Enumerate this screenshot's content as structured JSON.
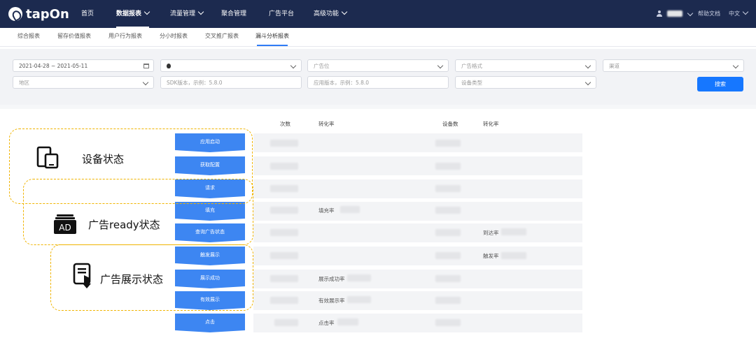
{
  "brand": {
    "name": "tapOn"
  },
  "nav": [
    {
      "label": "首页"
    },
    {
      "label": "数据报表",
      "active": true
    },
    {
      "label": "流量管理"
    },
    {
      "label": "聚合管理"
    },
    {
      "label": "广告平台"
    },
    {
      "label": "高级功能"
    }
  ],
  "top_right": {
    "help": "帮助文档",
    "lang": "中文"
  },
  "subtabs": [
    {
      "label": "综合报表"
    },
    {
      "label": "留存价值报表"
    },
    {
      "label": "用户行为报表"
    },
    {
      "label": "分小时报表"
    },
    {
      "label": "交叉推广报表"
    },
    {
      "label": "漏斗分析报表",
      "active": true
    }
  ],
  "filters": {
    "date_range": "2021-04-28 ~ 2021-05-11",
    "platform": "",
    "ad_slot": "广告位",
    "ad_format": "广告格式",
    "channel": "渠道",
    "region": "地区",
    "sdk_version": "SDK版本，示例：5.8.0",
    "app_version": "应用版本，示例：5.8.0",
    "device_type": "设备类型",
    "search_label": "搜索"
  },
  "table_headers": {
    "count": "次数",
    "conv_rate": "转化率",
    "device_count": "设备数",
    "conv_rate2": "转化率"
  },
  "funnel_steps": [
    {
      "label": "应用启动"
    },
    {
      "label": "获取配置"
    },
    {
      "label": "请求"
    },
    {
      "label": "填充",
      "rate_label": "填充率"
    },
    {
      "label": "查询广告状态",
      "device_rate_label": "到达率"
    },
    {
      "label": "触发展示",
      "device_rate_label": "触发率"
    },
    {
      "label": "展示成功",
      "rate_label": "展示成功率"
    },
    {
      "label": "有效展示",
      "rate_label": "有效展示率"
    },
    {
      "label": "点击",
      "rate_label": "点击率"
    }
  ],
  "groups": [
    {
      "label": "设备状态",
      "icon": "devices-icon"
    },
    {
      "label": "广告ready状态",
      "icon": "ad-badge-icon"
    },
    {
      "label": "广告展示状态",
      "icon": "display-touch-icon"
    }
  ],
  "colors": {
    "topbar": "#1c2a4f",
    "primary": "#1677ff",
    "funnel": "#3d86f2",
    "dash": "#f0b400"
  }
}
